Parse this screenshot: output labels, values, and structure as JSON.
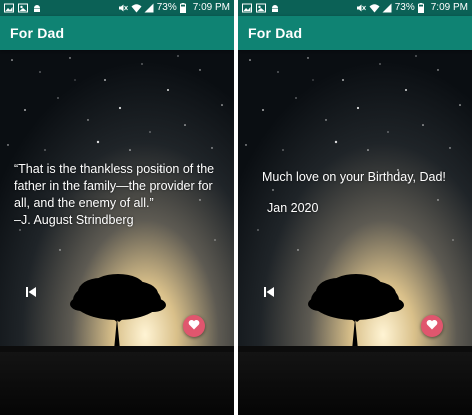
{
  "status_bar": {
    "battery": "73%",
    "time": "7:09 PM"
  },
  "app": {
    "title": "For Dad"
  },
  "left_screen": {
    "quote": "“That is the thankless position of the father in the family—the provider for all, and the enemy of all.”\n   –J. August Strindberg"
  },
  "right_screen": {
    "message": "Much love on your Birthday, Dad!",
    "date": "Jan 2020"
  },
  "icons": {
    "previous": "skip-previous-icon",
    "favorite": "heart-icon"
  },
  "colors": {
    "status_bar": "#0b6156",
    "app_bar": "#0f8373",
    "heart_button": "#e0566e"
  }
}
